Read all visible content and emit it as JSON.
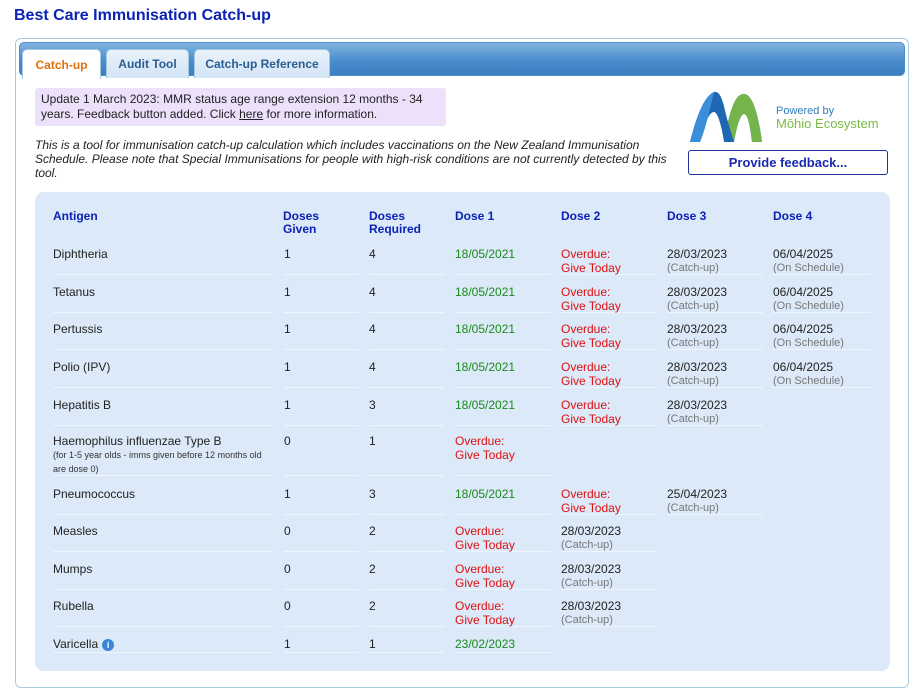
{
  "title": "Best Care Immunisation Catch-up",
  "tabs": [
    {
      "label": "Catch-up",
      "active": true
    },
    {
      "label": "Audit Tool",
      "active": false
    },
    {
      "label": "Catch-up Reference",
      "active": false
    }
  ],
  "notice": {
    "text_before": "Update 1 March 2023: MMR status age range extension 12 months - 34 years. Feedback button added. Click ",
    "link": "here",
    "text_after": " for more information."
  },
  "intro": "This is a tool for immunisation catch-up calculation which includes vaccinations on the New Zealand Immunisation Schedule. Please note that Special Immunisations for people with high-risk conditions are not currently detected by this tool.",
  "logo": {
    "powered_by": "Powered by",
    "brand": "Mōhio Ecosystem"
  },
  "feedback_button": "Provide feedback...",
  "colors": {
    "title": "#0b22b5",
    "done": "#1d8a1d",
    "overdue": "#e01010",
    "active_tab": "#e1700c",
    "table_bg": "#dbe9f8"
  },
  "table": {
    "headers": {
      "antigen": "Antigen",
      "given_1": "Doses",
      "given_2": "Given",
      "required_1": "Doses",
      "required_2": "Required",
      "dose1": "Dose 1",
      "dose2": "Dose 2",
      "dose3": "Dose 3",
      "dose4": "Dose 4"
    },
    "rows": [
      {
        "antigen": "Diphtheria",
        "given": "1",
        "required": "4",
        "d1": "18/05/2021",
        "d2_a": "Overdue:",
        "d2_b": "Give Today",
        "d3_a": "28/03/2023",
        "d3_b": "(Catch-up)",
        "d4_a": "06/04/2025",
        "d4_b": "(On Schedule)"
      },
      {
        "antigen": "Tetanus",
        "given": "1",
        "required": "4",
        "d1": "18/05/2021",
        "d2_a": "Overdue:",
        "d2_b": "Give Today",
        "d3_a": "28/03/2023",
        "d3_b": "(Catch-up)",
        "d4_a": "06/04/2025",
        "d4_b": "(On Schedule)"
      },
      {
        "antigen": "Pertussis",
        "given": "1",
        "required": "4",
        "d1": "18/05/2021",
        "d2_a": "Overdue:",
        "d2_b": "Give Today",
        "d3_a": "28/03/2023",
        "d3_b": "(Catch-up)",
        "d4_a": "06/04/2025",
        "d4_b": "(On Schedule)"
      },
      {
        "antigen": "Polio (IPV)",
        "given": "1",
        "required": "4",
        "d1": "18/05/2021",
        "d2_a": "Overdue:",
        "d2_b": "Give Today",
        "d3_a": "28/03/2023",
        "d3_b": "(Catch-up)",
        "d4_a": "06/04/2025",
        "d4_b": "(On Schedule)"
      },
      {
        "antigen": "Hepatitis B",
        "given": "1",
        "required": "3",
        "d1": "18/05/2021",
        "d2_a": "Overdue:",
        "d2_b": "Give Today",
        "d3_a": "28/03/2023",
        "d3_b": "(Catch-up)"
      },
      {
        "antigen": "Haemophilus influenzae Type B",
        "antigen_note": "(for 1-5 year olds - imms given before 12 months old are dose 0)",
        "given": "0",
        "required": "1",
        "d1_a": "Overdue:",
        "d1_b": "Give Today"
      },
      {
        "antigen": "Pneumococcus",
        "given": "1",
        "required": "3",
        "d1": "18/05/2021",
        "d2_a": "Overdue:",
        "d2_b": "Give Today",
        "d3_a": "25/04/2023",
        "d3_b": "(Catch-up)"
      },
      {
        "antigen": "Measles",
        "given": "0",
        "required": "2",
        "d1_a": "Overdue:",
        "d1_b": "Give Today",
        "d2_a": "28/03/2023",
        "d2_b": "(Catch-up)"
      },
      {
        "antigen": "Mumps",
        "given": "0",
        "required": "2",
        "d1_a": "Overdue:",
        "d1_b": "Give Today",
        "d2_a": "28/03/2023",
        "d2_b": "(Catch-up)"
      },
      {
        "antigen": "Rubella",
        "given": "0",
        "required": "2",
        "d1_a": "Overdue:",
        "d1_b": "Give Today",
        "d2_a": "28/03/2023",
        "d2_b": "(Catch-up)"
      },
      {
        "antigen": "Varicella",
        "given": "1",
        "required": "1",
        "d1": "23/02/2023",
        "info_icon": "info-icon"
      }
    ]
  }
}
